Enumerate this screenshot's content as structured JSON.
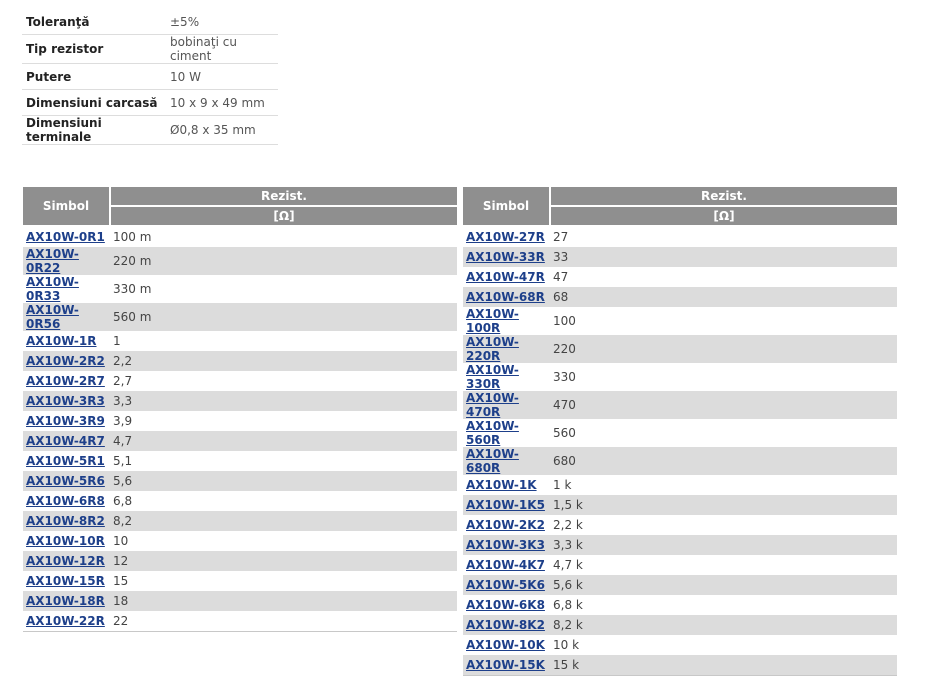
{
  "specs": [
    {
      "label": "Toleranţă",
      "value": "±5%"
    },
    {
      "label": "Tip rezistor",
      "value": "bobinaţi cu ciment"
    },
    {
      "label": "Putere",
      "value": "10 W"
    },
    {
      "label": "Dimensiuni carcasă",
      "value": "10 x 9 x 49 mm"
    },
    {
      "label": "Dimensiuni terminale",
      "value": "Ø0,8 x 35 mm"
    }
  ],
  "table_headers": {
    "symbol": "Simbol",
    "resistance": "Rezist.",
    "unit": "[Ω]"
  },
  "left_rows": [
    {
      "symbol": "AX10W-0R1",
      "value": "100 m"
    },
    {
      "symbol": "AX10W-0R22",
      "value": "220 m"
    },
    {
      "symbol": "AX10W-0R33",
      "value": "330 m"
    },
    {
      "symbol": "AX10W-0R56",
      "value": "560 m"
    },
    {
      "symbol": "AX10W-1R",
      "value": "1"
    },
    {
      "symbol": "AX10W-2R2",
      "value": "2,2"
    },
    {
      "symbol": "AX10W-2R7",
      "value": "2,7"
    },
    {
      "symbol": "AX10W-3R3",
      "value": "3,3"
    },
    {
      "symbol": "AX10W-3R9",
      "value": "3,9"
    },
    {
      "symbol": "AX10W-4R7",
      "value": "4,7"
    },
    {
      "symbol": "AX10W-5R1",
      "value": "5,1"
    },
    {
      "symbol": "AX10W-5R6",
      "value": "5,6"
    },
    {
      "symbol": "AX10W-6R8",
      "value": "6,8"
    },
    {
      "symbol": "AX10W-8R2",
      "value": "8,2"
    },
    {
      "symbol": "AX10W-10R",
      "value": "10"
    },
    {
      "symbol": "AX10W-12R",
      "value": "12"
    },
    {
      "symbol": "AX10W-15R",
      "value": "15"
    },
    {
      "symbol": "AX10W-18R",
      "value": "18"
    },
    {
      "symbol": "AX10W-22R",
      "value": "22"
    }
  ],
  "right_rows": [
    {
      "symbol": "AX10W-27R",
      "value": "27"
    },
    {
      "symbol": "AX10W-33R",
      "value": "33"
    },
    {
      "symbol": "AX10W-47R",
      "value": "47"
    },
    {
      "symbol": "AX10W-68R",
      "value": "68"
    },
    {
      "symbol": "AX10W-100R",
      "value": "100"
    },
    {
      "symbol": "AX10W-220R",
      "value": "220"
    },
    {
      "symbol": "AX10W-330R",
      "value": "330"
    },
    {
      "symbol": "AX10W-470R",
      "value": "470"
    },
    {
      "symbol": "AX10W-560R",
      "value": "560"
    },
    {
      "symbol": "AX10W-680R",
      "value": "680"
    },
    {
      "symbol": "AX10W-1K",
      "value": "1 k"
    },
    {
      "symbol": "AX10W-1K5",
      "value": "1,5 k"
    },
    {
      "symbol": "AX10W-2K2",
      "value": "2,2 k"
    },
    {
      "symbol": "AX10W-3K3",
      "value": "3,3 k"
    },
    {
      "symbol": "AX10W-4K7",
      "value": "4,7 k"
    },
    {
      "symbol": "AX10W-5K6",
      "value": "5,6 k"
    },
    {
      "symbol": "AX10W-6K8",
      "value": "6,8 k"
    },
    {
      "symbol": "AX10W-8K2",
      "value": "8,2 k"
    },
    {
      "symbol": "AX10W-10K",
      "value": "10 k"
    },
    {
      "symbol": "AX10W-15K",
      "value": "15 k"
    }
  ],
  "colors": {
    "header_bg": "#8f8f8f",
    "row_alt_bg": "#dcdcdc",
    "link": "#1d3f8a"
  }
}
